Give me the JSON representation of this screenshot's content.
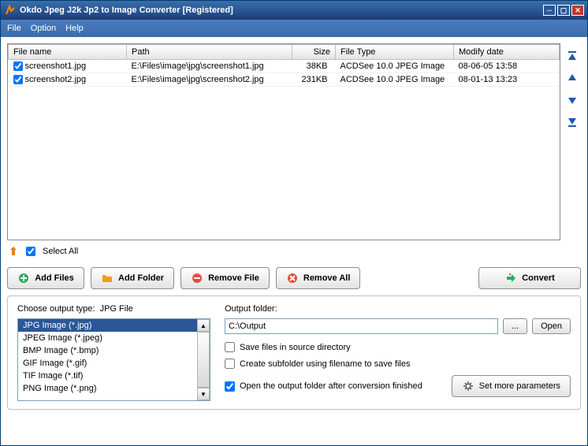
{
  "window": {
    "title": "Okdo Jpeg J2k Jp2 to Image Converter [Registered]"
  },
  "menu": {
    "file": "File",
    "option": "Option",
    "help": "Help"
  },
  "headers": {
    "filename": "File name",
    "path": "Path",
    "size": "Size",
    "filetype": "File Type",
    "modify": "Modify date"
  },
  "rows": [
    {
      "name": "screenshot1.jpg",
      "path": "E:\\Files\\image\\jpg\\screenshot1.jpg",
      "size": "38KB",
      "type": "ACDSee 10.0 JPEG Image",
      "modify": "08-06-05 13:58"
    },
    {
      "name": "screenshot2.jpg",
      "path": "E:\\Files\\image\\jpg\\screenshot2.jpg",
      "size": "231KB",
      "type": "ACDSee 10.0 JPEG Image",
      "modify": "08-01-13 13:23"
    }
  ],
  "selectall": "Select All",
  "buttons": {
    "add_files": "Add Files",
    "add_folder": "Add Folder",
    "remove_file": "Remove File",
    "remove_all": "Remove All",
    "convert": "Convert"
  },
  "output_type": {
    "label": "Choose output type:",
    "current": "JPG File"
  },
  "typelist": [
    "JPG Image (*.jpg)",
    "JPEG Image (*.jpeg)",
    "BMP Image (*.bmp)",
    "GIF Image (*.gif)",
    "TIF Image (*.tif)",
    "PNG Image (*.png)"
  ],
  "outfolder": {
    "label": "Output folder:",
    "value": "C:\\Output",
    "browse": "...",
    "open": "Open"
  },
  "checks": {
    "save_source": "Save files in source directory",
    "subfolder": "Create subfolder using filename to save files",
    "open_after": "Open the output folder after conversion finished"
  },
  "more_params": "Set more parameters"
}
